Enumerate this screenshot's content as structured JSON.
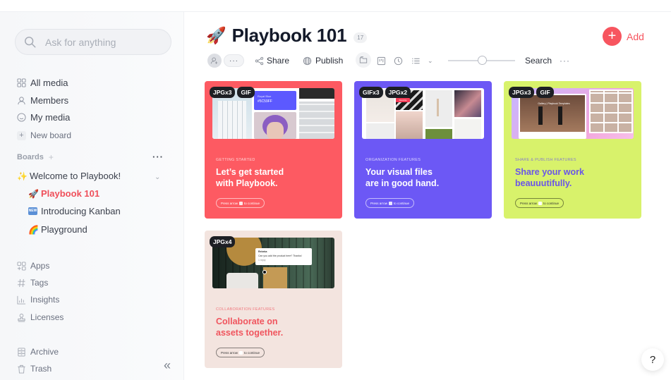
{
  "sidebar": {
    "search_placeholder": "Ask for anything",
    "nav": [
      {
        "label": "All media",
        "icon": "grid-icon"
      },
      {
        "label": "Members",
        "icon": "user-icon"
      },
      {
        "label": "My media",
        "icon": "smiley-icon"
      },
      {
        "label": "New board",
        "icon": "plus-icon"
      }
    ],
    "boards_label": "Boards",
    "boards": [
      {
        "emoji": "✨",
        "label": "Welcome to Playbook!"
      },
      {
        "emoji": "🚀",
        "label": "Playbook 101",
        "active": true
      },
      {
        "emoji": "NEW",
        "label": "Introducing Kanban"
      },
      {
        "emoji": "🌈",
        "label": "Playground"
      }
    ],
    "tools": [
      {
        "label": "Apps",
        "icon": "apps-icon"
      },
      {
        "label": "Tags",
        "icon": "hash-icon"
      },
      {
        "label": "Insights",
        "icon": "chart-icon"
      },
      {
        "label": "Licenses",
        "icon": "stamp-icon"
      }
    ],
    "bottom": [
      {
        "label": "Archive",
        "icon": "archive-icon"
      },
      {
        "label": "Trash",
        "icon": "trash-icon"
      }
    ],
    "collapse_glyph": "«"
  },
  "header": {
    "emoji": "🚀",
    "title": "Playbook 101",
    "count": "17",
    "add_label": "Add"
  },
  "toolbar": {
    "more_glyph": "···",
    "share_label": "Share",
    "publish_label": "Publish",
    "zoom_level": 0.5,
    "search_label": "Search",
    "overflow_glyph": "···"
  },
  "cards": [
    {
      "tags": [
        "JPGx3",
        "GIF"
      ],
      "eyebrow": "Getting Started",
      "headline_1": "Let’s get started",
      "headline_2": "with Playbook.",
      "hint": "Press arrow",
      "hint_suffix": "to continue",
      "preview_text_1": "Royal Blue",
      "preview_text_2": "#5C59FF",
      "bg": "#fd5a62",
      "text_color": "#ffffff"
    },
    {
      "tags": [
        "GIFx3",
        "JPGx2"
      ],
      "eyebrow": "Organization Features",
      "headline_1": "Your visual files",
      "headline_2": "are in good hand.",
      "hint": "Press arrow",
      "hint_suffix": "to continue",
      "preview_text_1": "Favorite",
      "bg": "#6c58f5",
      "text_color": "#ffffff"
    },
    {
      "tags": [
        "JPGx3",
        "GIF"
      ],
      "eyebrow": "Share & Publish Features",
      "headline_1": "Share your work",
      "headline_2": "beauuutifully.",
      "hint": "Press arrow",
      "hint_suffix": "to continue",
      "preview_text_1": "Gallery | Playbook Templates",
      "bg": "#d8f26b",
      "text_color": "#6a55e8"
    },
    {
      "tags": [
        "JPGx4"
      ],
      "eyebrow": "Collaboration Features",
      "headline_1": "Collaborate on",
      "headline_2": "assets together.",
      "hint": "Press arrow",
      "hint_suffix": "to continue",
      "preview_text_1": "Rebeka",
      "preview_text_2": "Can you add the product here? Thanks!",
      "preview_text_3": "1 reply",
      "bg": "#f3e4df",
      "text_color": "#f0555e"
    }
  ],
  "help_glyph": "?"
}
